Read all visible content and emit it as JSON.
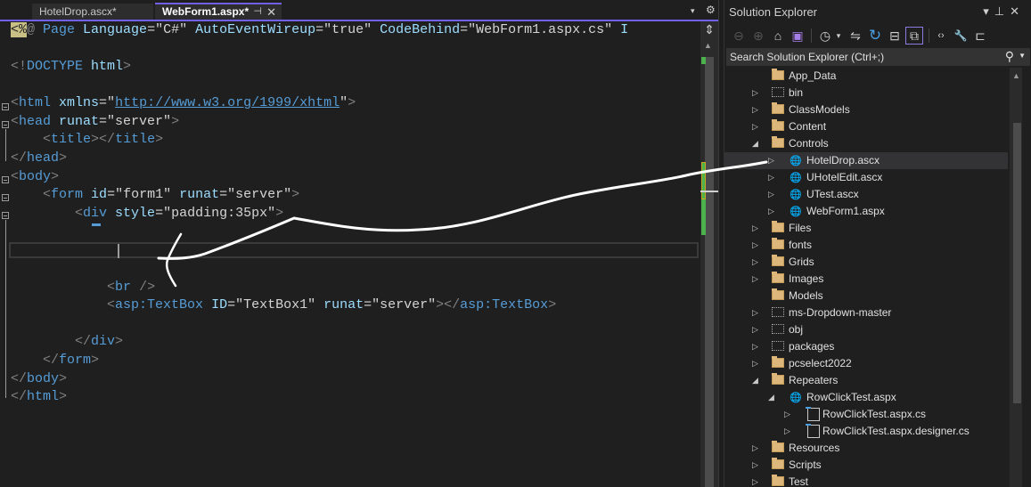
{
  "editor": {
    "tabs": [
      {
        "label": "HotelDrop.ascx*",
        "active": false
      },
      {
        "label": "WebForm1.aspx*",
        "active": true,
        "pin_icon": "⊣",
        "close_icon": "✕"
      }
    ],
    "tab_dropdown_icon": "▾",
    "settings_icon": "⚙",
    "code_lines": {
      "l1": {
        "open": "<%",
        "at": "@",
        "rest1": " Page ",
        "a1": "Language",
        "eq1": "=\"C#\" ",
        "a2": "AutoEventWireup",
        "eq2": "=\"true\" ",
        "a3": "CodeBehind",
        "eq3": "=\"WebForm1.aspx.cs\" ",
        "a4": "I"
      },
      "l2": {
        "lt": "<!",
        "name": "DOCTYPE",
        "rest": " html",
        "gt": ">"
      },
      "l3": {
        "lt": "<",
        "name": "html",
        "attr": " xmlns",
        "eq": "=\"",
        "url": "http://www.w3.org/1999/xhtml",
        "q": "\"",
        "gt": ">"
      },
      "l4": {
        "lt": "<",
        "name": "head",
        "attr": " runat",
        "val": "=\"server\"",
        "gt": ">"
      },
      "l5": {
        "indent": "    ",
        "lt": "<",
        "name": "title",
        "mid": "></",
        "name2": "title",
        "gt": ">"
      },
      "l6": {
        "lt": "</",
        "name": "head",
        "gt": ">"
      },
      "l7": {
        "lt": "<",
        "name": "body",
        "gt": ">"
      },
      "l8": {
        "indent": "    ",
        "lt": "<",
        "name": "form",
        "attr1": " id",
        "val1": "=\"form1\"",
        "attr2": " runat",
        "val2": "=\"server\"",
        "gt": ">"
      },
      "l9": {
        "indent": "        ",
        "lt": "<",
        "name": "div",
        "attr": " style",
        "val": "=\"padding:35px\"",
        "gt": ">"
      },
      "l10": {
        "indent": "            ",
        "lt": "<",
        "name": "br",
        "gt": " />"
      },
      "l11": {
        "indent": "            ",
        "lt": "<",
        "name": "asp:TextBox",
        "attr1": " ID",
        "val1": "=\"TextBox1\"",
        "attr2": " runat",
        "val2": "=\"server\"",
        "mid": "></",
        "name2": "asp:TextBox",
        "gt": ">"
      },
      "l12": {
        "indent": "        ",
        "lt": "</",
        "name": "div",
        "gt": ">"
      },
      "l13": {
        "indent": "    ",
        "lt": "</",
        "name": "form",
        "gt": ">"
      },
      "l14": {
        "lt": "</",
        "name": "body",
        "gt": ">"
      },
      "l15": {
        "lt": "</",
        "name": "html",
        "gt": ">"
      }
    },
    "split_icon": "⇕",
    "scroll_up_icon": "▲"
  },
  "solution_explorer": {
    "title": "Solution Explorer",
    "window_controls": [
      "▾",
      "⊥",
      "✕"
    ],
    "toolbar": [
      {
        "name": "back-icon",
        "glyph": "⊖"
      },
      {
        "name": "forward-icon",
        "glyph": "⊕"
      },
      {
        "name": "home-icon",
        "glyph": "⌂"
      },
      {
        "name": "vs-solution-icon",
        "glyph": "▣"
      },
      {
        "name": "pending-changes-icon",
        "glyph": "◷"
      },
      {
        "name": "dropdown-icon",
        "glyph": "▾"
      },
      {
        "name": "sync-icon",
        "glyph": "⇋"
      },
      {
        "name": "refresh-icon",
        "glyph": "↻"
      },
      {
        "name": "collapse-all-icon",
        "glyph": "⊟"
      },
      {
        "name": "show-all-files-icon",
        "glyph": "⧉"
      },
      {
        "name": "view-code-icon",
        "glyph": "‹›"
      },
      {
        "name": "properties-icon",
        "glyph": "🔧"
      },
      {
        "name": "preview-icon",
        "glyph": "⊏"
      }
    ],
    "search_placeholder": "Search Solution Explorer (Ctrl+;)",
    "search_icon": "⚲",
    "tree": [
      {
        "label": "App_Data",
        "type": "folder",
        "level": 0,
        "arrow": ""
      },
      {
        "label": "bin",
        "type": "folder-hidden",
        "level": 0,
        "arrow": "▷"
      },
      {
        "label": "ClassModels",
        "type": "folder",
        "level": 0,
        "arrow": "▷"
      },
      {
        "label": "Content",
        "type": "folder",
        "level": 0,
        "arrow": "▷"
      },
      {
        "label": "Controls",
        "type": "folder",
        "level": 0,
        "arrow": "◢"
      },
      {
        "label": "HotelDrop.ascx",
        "type": "web-control",
        "level": 1,
        "arrow": "▷",
        "selected": true
      },
      {
        "label": "UHotelEdit.ascx",
        "type": "web-control",
        "level": 1,
        "arrow": "▷"
      },
      {
        "label": "UTest.ascx",
        "type": "web-control",
        "level": 1,
        "arrow": "▷"
      },
      {
        "label": "WebForm1.aspx",
        "type": "web-page",
        "level": 1,
        "arrow": "▷"
      },
      {
        "label": "Files",
        "type": "folder",
        "level": 0,
        "arrow": "▷"
      },
      {
        "label": "fonts",
        "type": "folder",
        "level": 0,
        "arrow": "▷"
      },
      {
        "label": "Grids",
        "type": "folder",
        "level": 0,
        "arrow": "▷"
      },
      {
        "label": "Images",
        "type": "folder",
        "level": 0,
        "arrow": "▷"
      },
      {
        "label": "Models",
        "type": "folder",
        "level": 0,
        "arrow": ""
      },
      {
        "label": "ms-Dropdown-master",
        "type": "folder-hidden",
        "level": 0,
        "arrow": "▷"
      },
      {
        "label": "obj",
        "type": "folder-hidden",
        "level": 0,
        "arrow": "▷"
      },
      {
        "label": "packages",
        "type": "folder-hidden",
        "level": 0,
        "arrow": "▷"
      },
      {
        "label": "pcselect2022",
        "type": "folder",
        "level": 0,
        "arrow": "▷"
      },
      {
        "label": "Repeaters",
        "type": "folder",
        "level": 0,
        "arrow": "◢"
      },
      {
        "label": "RowClickTest.aspx",
        "type": "web-page",
        "level": 1,
        "arrow": "◢"
      },
      {
        "label": "RowClickTest.aspx.cs",
        "type": "cs-file",
        "level": 2,
        "arrow": "▷"
      },
      {
        "label": "RowClickTest.aspx.designer.cs",
        "type": "cs-file",
        "level": 2,
        "arrow": "▷"
      },
      {
        "label": "Resources",
        "type": "folder",
        "level": 0,
        "arrow": "▷"
      },
      {
        "label": "Scripts",
        "type": "folder",
        "level": 0,
        "arrow": "▷"
      },
      {
        "label": "Test",
        "type": "folder",
        "level": 0,
        "arrow": "▷"
      }
    ]
  },
  "colors": {
    "accent": "#7160e8",
    "element": "#569cd6",
    "attribute": "#9cdcfe",
    "folder": "#dcb67a",
    "scroll_mark_green": "#4cb34c"
  }
}
